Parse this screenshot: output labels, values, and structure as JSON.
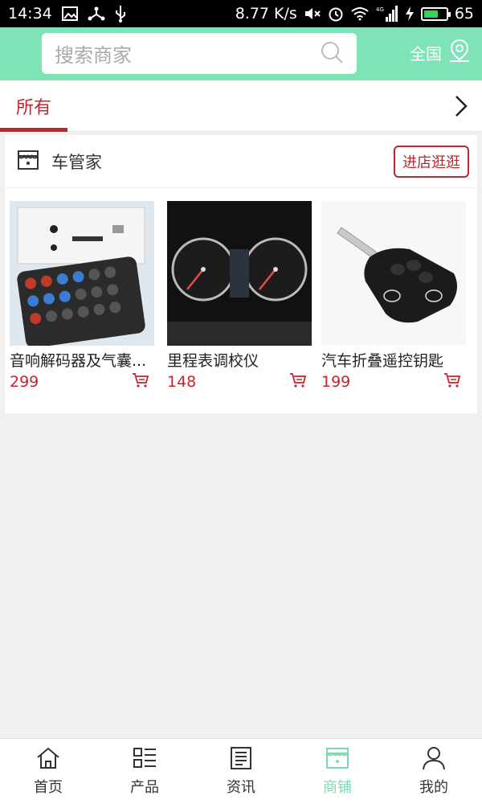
{
  "status_bar": {
    "time": "14:34",
    "network_speed": "8.77 K/s",
    "network_type": "4G",
    "battery": "65"
  },
  "header": {
    "search_placeholder": "搜索商家",
    "region_label": "全国",
    "background_color": "#7fe3b8"
  },
  "tabs": {
    "active_label": "所有"
  },
  "shop": {
    "name": "车管家",
    "visit_button": "进店逛逛",
    "accent_color": "#c0262c",
    "products": [
      {
        "name": "音响解码器及气囊...",
        "price": "299"
      },
      {
        "name": "里程表调校仪",
        "price": "148"
      },
      {
        "name": "汽车折叠遥控钥匙",
        "price": "199"
      }
    ]
  },
  "bottom_nav": {
    "items": [
      {
        "label": "首页",
        "icon": "home-icon"
      },
      {
        "label": "产品",
        "icon": "grid-list-icon"
      },
      {
        "label": "资讯",
        "icon": "news-icon"
      },
      {
        "label": "商铺",
        "icon": "store-icon"
      },
      {
        "label": "我的",
        "icon": "user-icon"
      }
    ],
    "active_index": 3,
    "active_color": "#7fd9b0"
  }
}
